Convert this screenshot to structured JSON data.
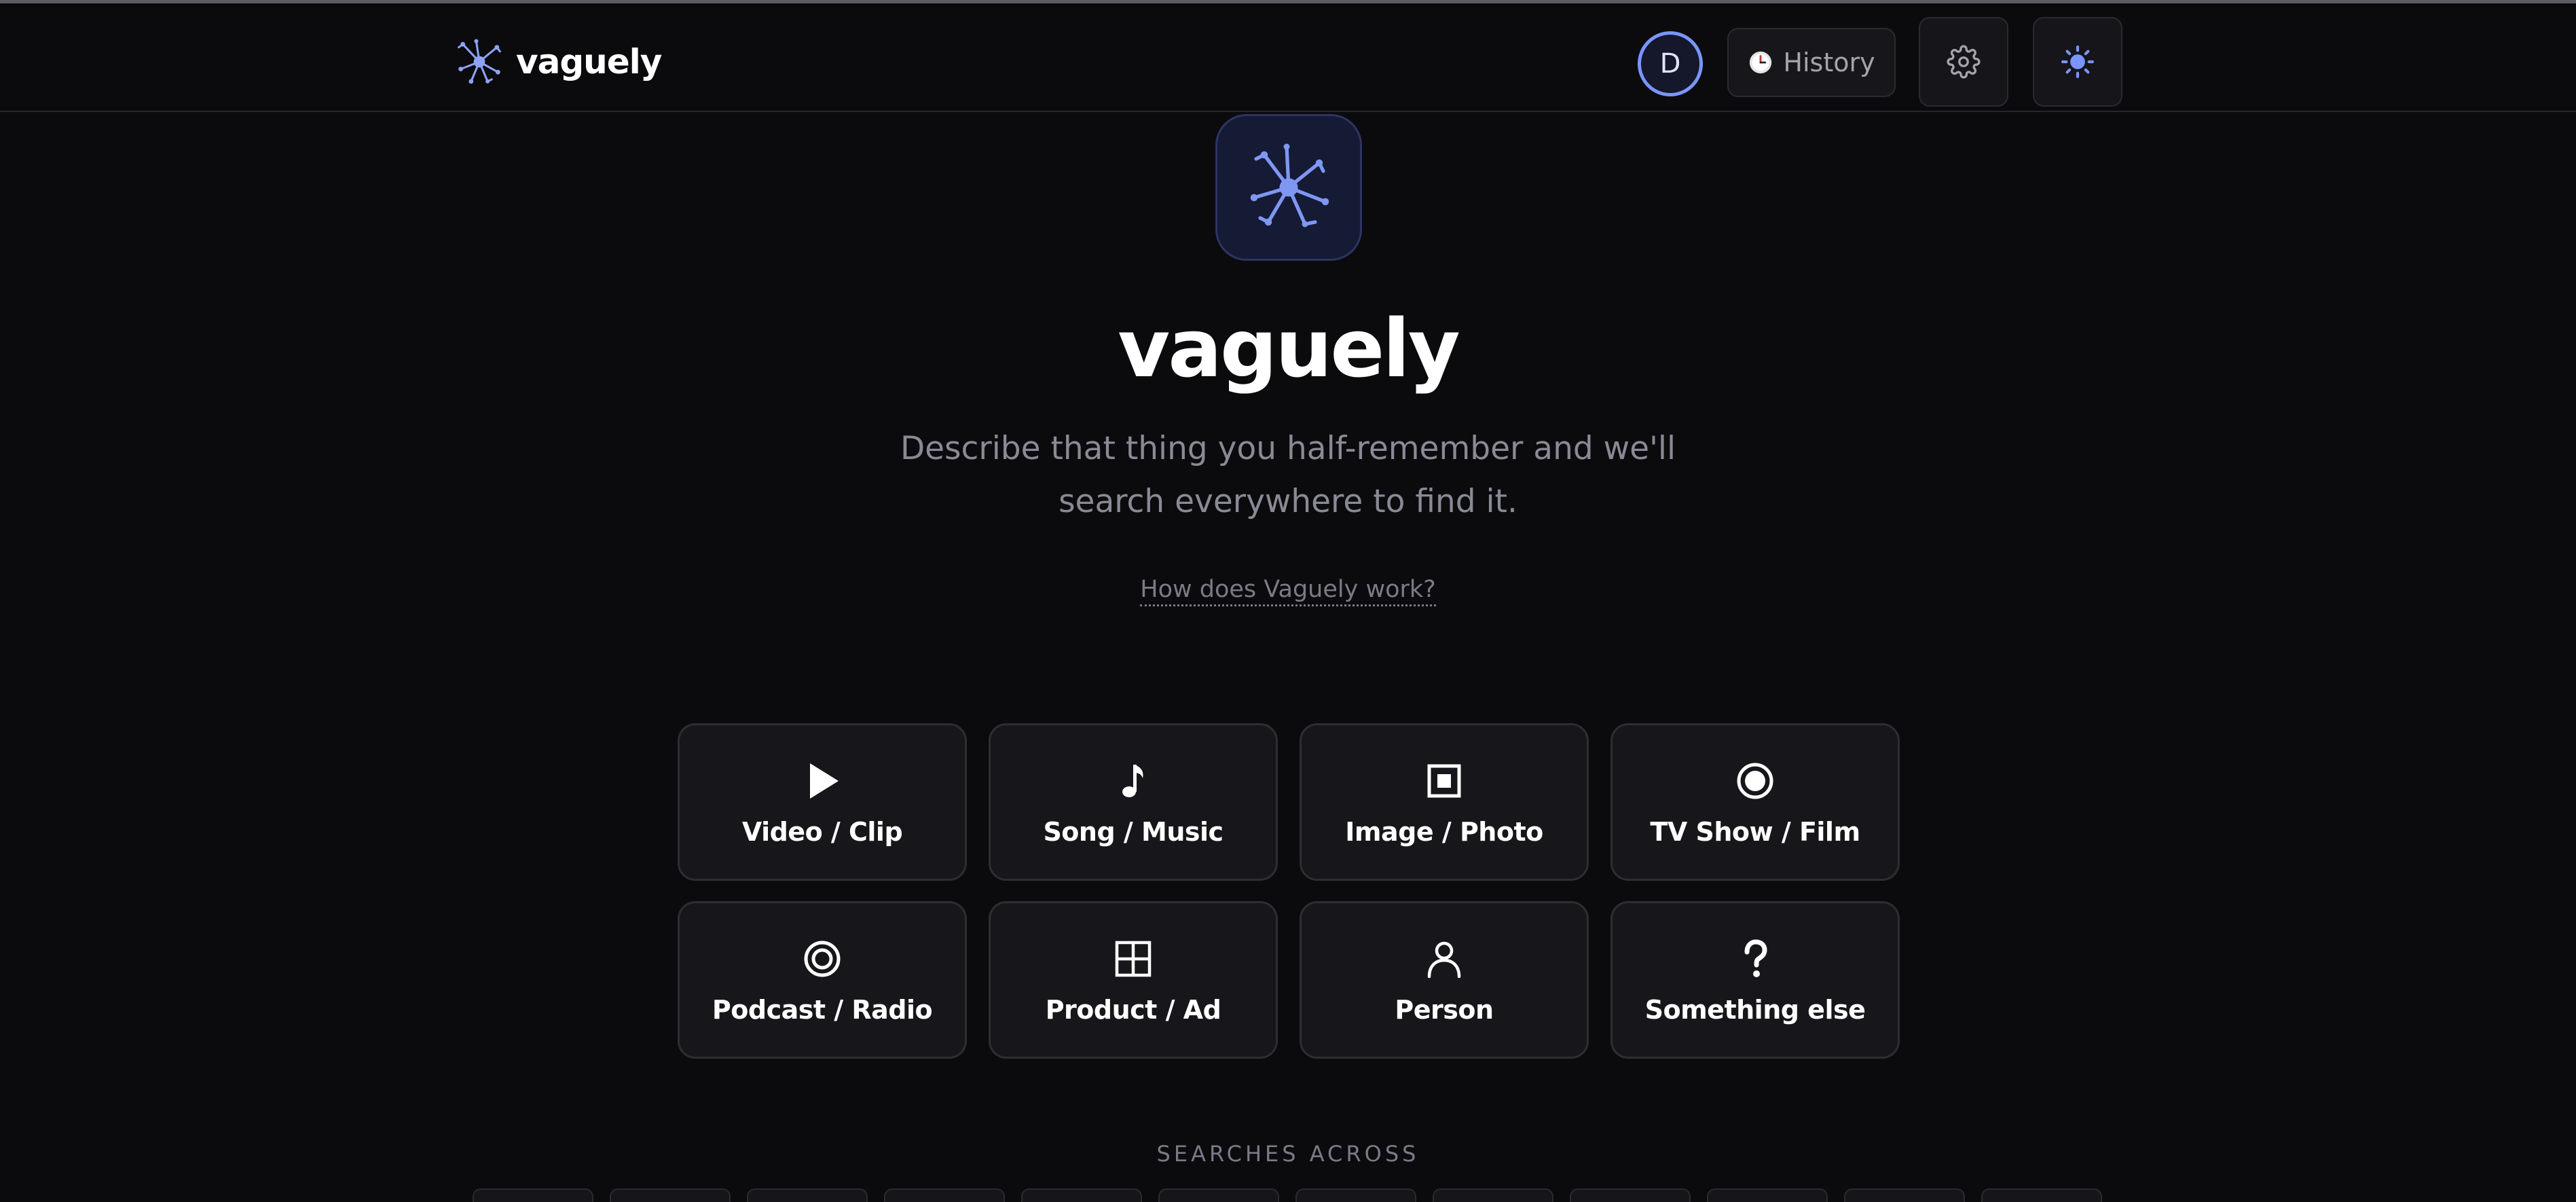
{
  "header": {
    "brand_name": "vaguely",
    "avatar_initial": "D",
    "history_label": "History"
  },
  "hero": {
    "title": "vaguely",
    "subtitle": "Describe that thing you half-remember and we'll search everywhere to find it.",
    "how_link": "How does Vaguely work?"
  },
  "categories": [
    {
      "label": "Video / Clip",
      "icon": "play-icon"
    },
    {
      "label": "Song / Music",
      "icon": "music-note-icon"
    },
    {
      "label": "Image / Photo",
      "icon": "image-icon"
    },
    {
      "label": "TV Show / Film",
      "icon": "record-icon"
    },
    {
      "label": "Podcast / Radio",
      "icon": "podcast-icon"
    },
    {
      "label": "Product / Ad",
      "icon": "grid-icon"
    },
    {
      "label": "Person",
      "icon": "person-icon"
    },
    {
      "label": "Something else",
      "icon": "question-icon"
    }
  ],
  "footer": {
    "searches_across": "SEARCHES ACROSS"
  },
  "colors": {
    "background": "#0b0b0d",
    "accent": "#7a95ff",
    "card_bg": "#17171b",
    "muted_text": "#8a8a96"
  }
}
